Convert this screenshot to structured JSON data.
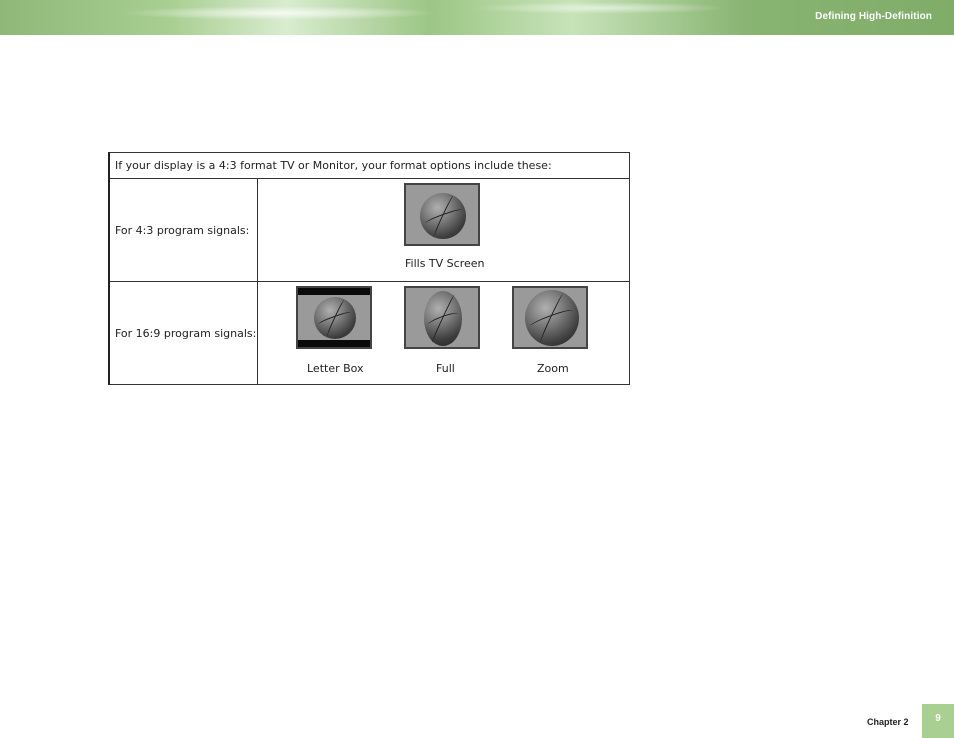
{
  "header": {
    "title": "Defining High-Definition"
  },
  "table": {
    "intro": "If your display is a 4:3 format TV or Monitor, your format options include these:",
    "rows": [
      {
        "label": "For 4:3 program signals:",
        "items": [
          {
            "caption": "Fills TV Screen"
          }
        ]
      },
      {
        "label": "For 16:9 program signals:",
        "items": [
          {
            "caption": "Letter Box"
          },
          {
            "caption": "Full"
          },
          {
            "caption": "Zoom"
          }
        ]
      }
    ]
  },
  "footer": {
    "chapter": "Chapter 2",
    "page": "9"
  },
  "colors": {
    "accent_green": "#a9cf93"
  }
}
